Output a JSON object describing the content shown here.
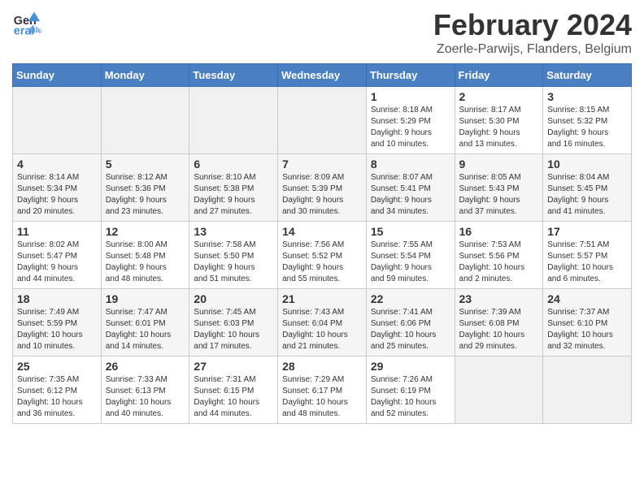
{
  "header": {
    "logo_line1": "General",
    "logo_line2": "Blue",
    "month": "February 2024",
    "location": "Zoerle-Parwijs, Flanders, Belgium"
  },
  "days_of_week": [
    "Sunday",
    "Monday",
    "Tuesday",
    "Wednesday",
    "Thursday",
    "Friday",
    "Saturday"
  ],
  "weeks": [
    [
      {
        "day": "",
        "info": ""
      },
      {
        "day": "",
        "info": ""
      },
      {
        "day": "",
        "info": ""
      },
      {
        "day": "",
        "info": ""
      },
      {
        "day": "1",
        "info": "Sunrise: 8:18 AM\nSunset: 5:29 PM\nDaylight: 9 hours\nand 10 minutes."
      },
      {
        "day": "2",
        "info": "Sunrise: 8:17 AM\nSunset: 5:30 PM\nDaylight: 9 hours\nand 13 minutes."
      },
      {
        "day": "3",
        "info": "Sunrise: 8:15 AM\nSunset: 5:32 PM\nDaylight: 9 hours\nand 16 minutes."
      }
    ],
    [
      {
        "day": "4",
        "info": "Sunrise: 8:14 AM\nSunset: 5:34 PM\nDaylight: 9 hours\nand 20 minutes."
      },
      {
        "day": "5",
        "info": "Sunrise: 8:12 AM\nSunset: 5:36 PM\nDaylight: 9 hours\nand 23 minutes."
      },
      {
        "day": "6",
        "info": "Sunrise: 8:10 AM\nSunset: 5:38 PM\nDaylight: 9 hours\nand 27 minutes."
      },
      {
        "day": "7",
        "info": "Sunrise: 8:09 AM\nSunset: 5:39 PM\nDaylight: 9 hours\nand 30 minutes."
      },
      {
        "day": "8",
        "info": "Sunrise: 8:07 AM\nSunset: 5:41 PM\nDaylight: 9 hours\nand 34 minutes."
      },
      {
        "day": "9",
        "info": "Sunrise: 8:05 AM\nSunset: 5:43 PM\nDaylight: 9 hours\nand 37 minutes."
      },
      {
        "day": "10",
        "info": "Sunrise: 8:04 AM\nSunset: 5:45 PM\nDaylight: 9 hours\nand 41 minutes."
      }
    ],
    [
      {
        "day": "11",
        "info": "Sunrise: 8:02 AM\nSunset: 5:47 PM\nDaylight: 9 hours\nand 44 minutes."
      },
      {
        "day": "12",
        "info": "Sunrise: 8:00 AM\nSunset: 5:48 PM\nDaylight: 9 hours\nand 48 minutes."
      },
      {
        "day": "13",
        "info": "Sunrise: 7:58 AM\nSunset: 5:50 PM\nDaylight: 9 hours\nand 51 minutes."
      },
      {
        "day": "14",
        "info": "Sunrise: 7:56 AM\nSunset: 5:52 PM\nDaylight: 9 hours\nand 55 minutes."
      },
      {
        "day": "15",
        "info": "Sunrise: 7:55 AM\nSunset: 5:54 PM\nDaylight: 9 hours\nand 59 minutes."
      },
      {
        "day": "16",
        "info": "Sunrise: 7:53 AM\nSunset: 5:56 PM\nDaylight: 10 hours\nand 2 minutes."
      },
      {
        "day": "17",
        "info": "Sunrise: 7:51 AM\nSunset: 5:57 PM\nDaylight: 10 hours\nand 6 minutes."
      }
    ],
    [
      {
        "day": "18",
        "info": "Sunrise: 7:49 AM\nSunset: 5:59 PM\nDaylight: 10 hours\nand 10 minutes."
      },
      {
        "day": "19",
        "info": "Sunrise: 7:47 AM\nSunset: 6:01 PM\nDaylight: 10 hours\nand 14 minutes."
      },
      {
        "day": "20",
        "info": "Sunrise: 7:45 AM\nSunset: 6:03 PM\nDaylight: 10 hours\nand 17 minutes."
      },
      {
        "day": "21",
        "info": "Sunrise: 7:43 AM\nSunset: 6:04 PM\nDaylight: 10 hours\nand 21 minutes."
      },
      {
        "day": "22",
        "info": "Sunrise: 7:41 AM\nSunset: 6:06 PM\nDaylight: 10 hours\nand 25 minutes."
      },
      {
        "day": "23",
        "info": "Sunrise: 7:39 AM\nSunset: 6:08 PM\nDaylight: 10 hours\nand 29 minutes."
      },
      {
        "day": "24",
        "info": "Sunrise: 7:37 AM\nSunset: 6:10 PM\nDaylight: 10 hours\nand 32 minutes."
      }
    ],
    [
      {
        "day": "25",
        "info": "Sunrise: 7:35 AM\nSunset: 6:12 PM\nDaylight: 10 hours\nand 36 minutes."
      },
      {
        "day": "26",
        "info": "Sunrise: 7:33 AM\nSunset: 6:13 PM\nDaylight: 10 hours\nand 40 minutes."
      },
      {
        "day": "27",
        "info": "Sunrise: 7:31 AM\nSunset: 6:15 PM\nDaylight: 10 hours\nand 44 minutes."
      },
      {
        "day": "28",
        "info": "Sunrise: 7:29 AM\nSunset: 6:17 PM\nDaylight: 10 hours\nand 48 minutes."
      },
      {
        "day": "29",
        "info": "Sunrise: 7:26 AM\nSunset: 6:19 PM\nDaylight: 10 hours\nand 52 minutes."
      },
      {
        "day": "",
        "info": ""
      },
      {
        "day": "",
        "info": ""
      }
    ]
  ]
}
